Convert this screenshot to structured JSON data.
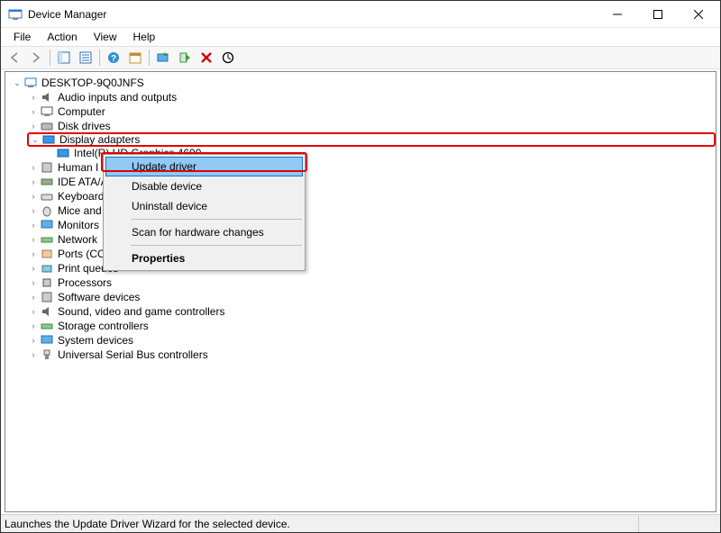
{
  "window": {
    "title": "Device Manager"
  },
  "menu": {
    "file": "File",
    "action": "Action",
    "view": "View",
    "help": "Help"
  },
  "tree": {
    "root": "DESKTOP-9Q0JNFS",
    "items": [
      "Audio inputs and outputs",
      "Computer",
      "Disk drives",
      "Display adapters",
      "Intel(R) HD Graphics 4600",
      "Human Interface Devices",
      "IDE ATA/ATAPI controllers",
      "Keyboards",
      "Mice and other pointing devices",
      "Monitors",
      "Network adapters",
      "Ports (COM & LPT)",
      "Print queues",
      "Processors",
      "Software devices",
      "Sound, video and game controllers",
      "Storage controllers",
      "System devices",
      "Universal Serial Bus controllers"
    ],
    "items_trunc": {
      "hid": "Human I",
      "ide": "IDE ATA/A",
      "keyboard": "Keyboard",
      "mice": "Mice and",
      "monitors": "Monitors",
      "network": "Network",
      "ports": "Ports (CO",
      "intel": "Intel(R) HD Graphics 4600"
    }
  },
  "context_menu": {
    "update": "Update driver",
    "disable": "Disable device",
    "uninstall": "Uninstall device",
    "scan": "Scan for hardware changes",
    "properties": "Properties"
  },
  "status": {
    "text": "Launches the Update Driver Wizard for the selected device."
  }
}
